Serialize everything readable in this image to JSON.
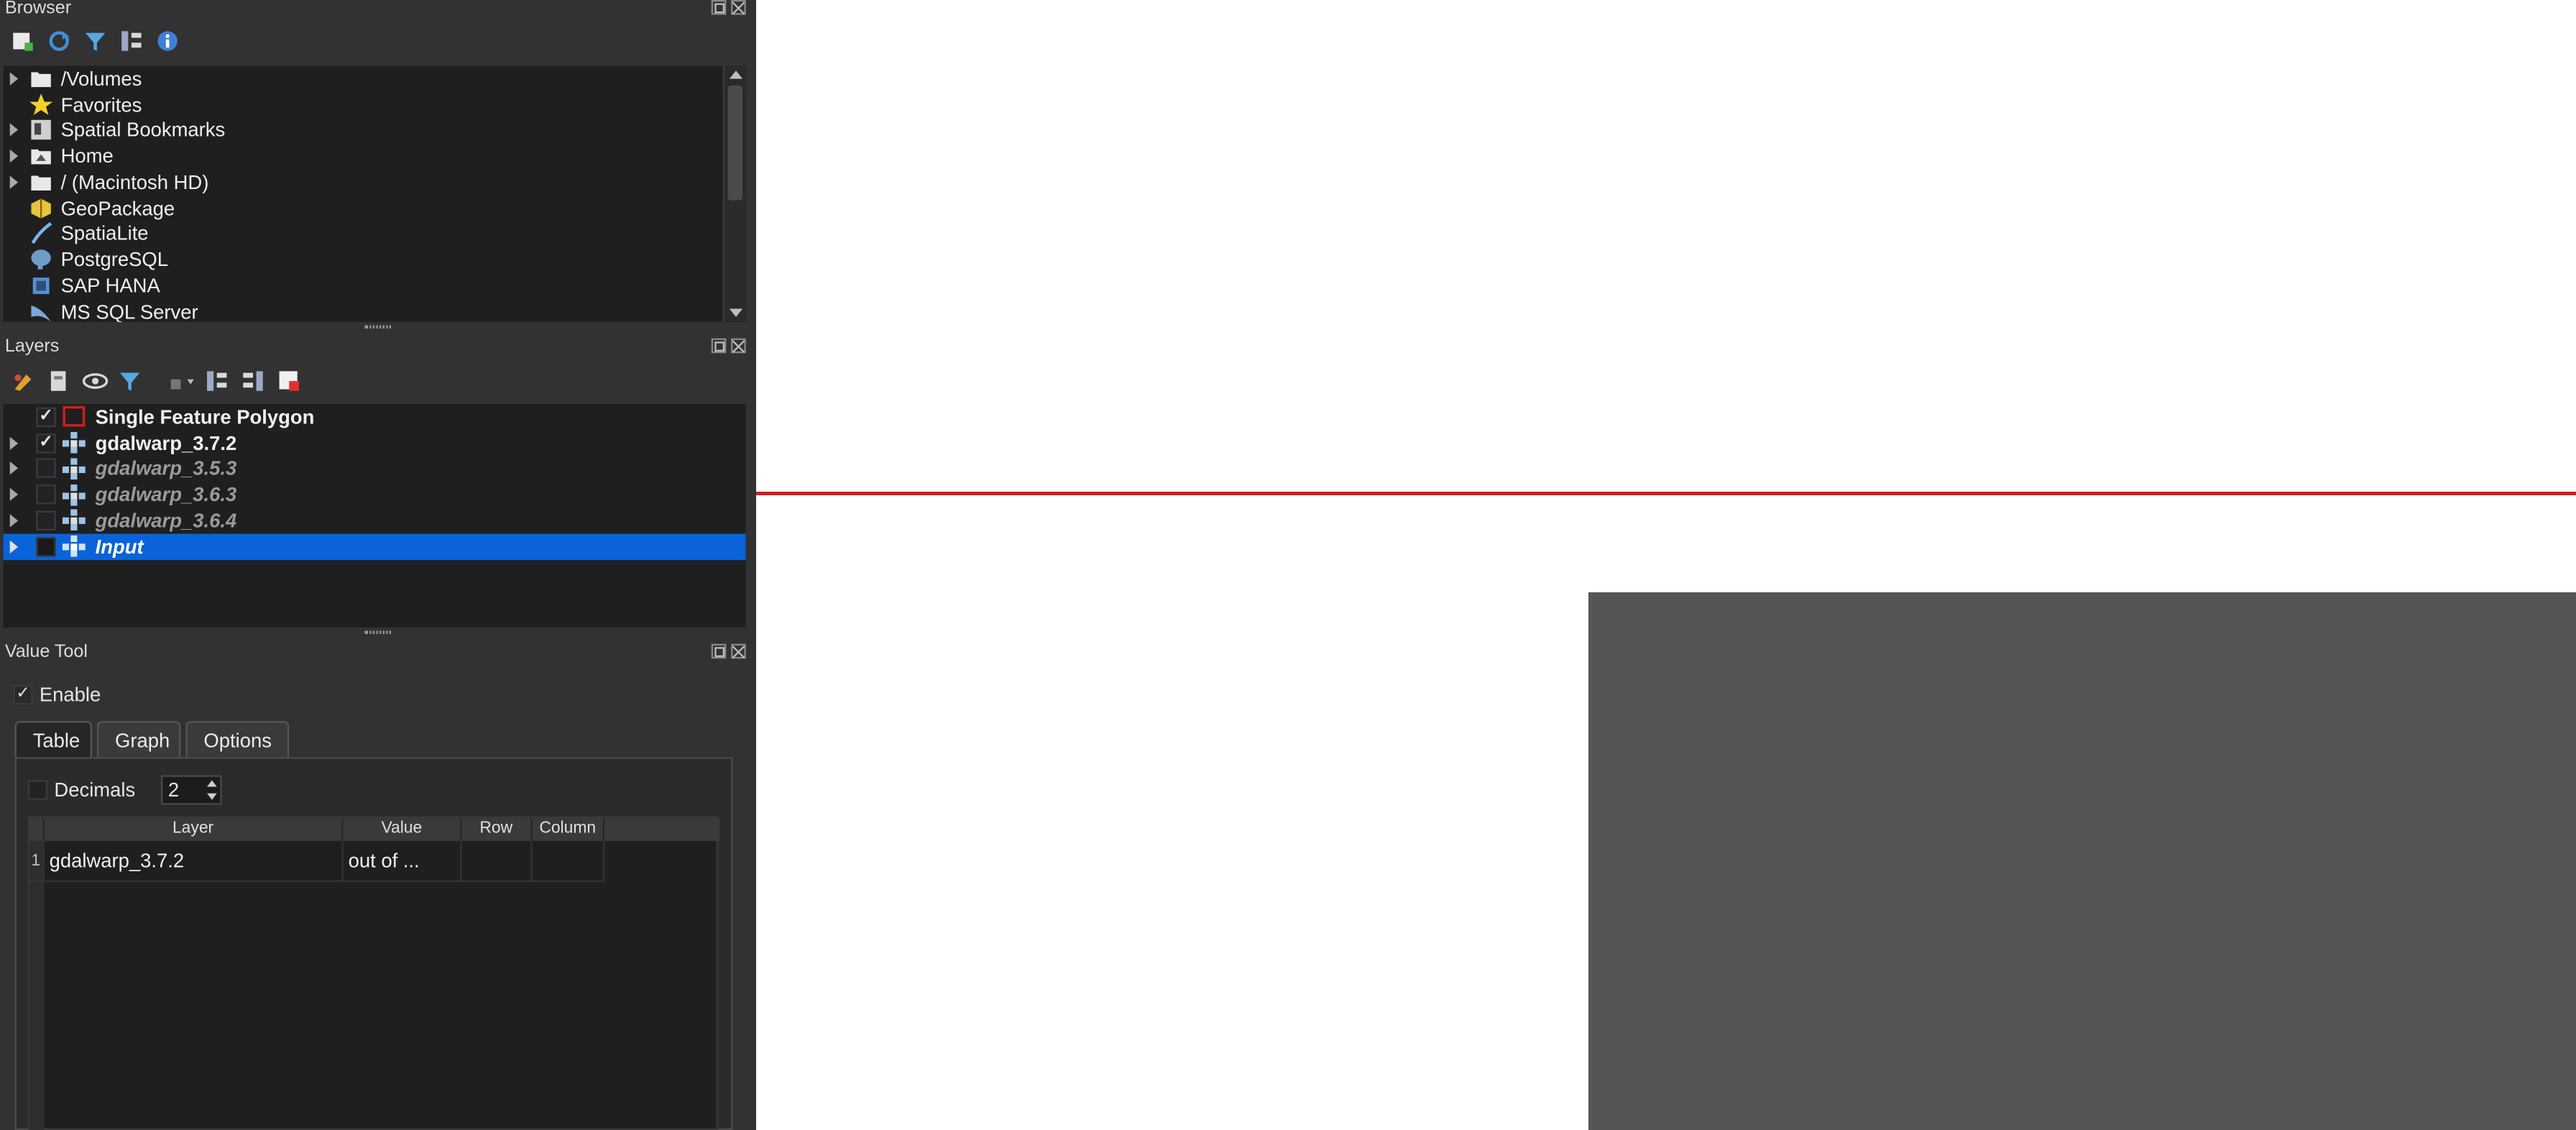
{
  "browser": {
    "title": "Browser",
    "items": [
      {
        "label": "/Volumes",
        "icon": "folder-icon",
        "expandable": true
      },
      {
        "label": "Favorites",
        "icon": "star-icon",
        "expandable": false
      },
      {
        "label": "Spatial Bookmarks",
        "icon": "bookmark-icon",
        "expandable": true
      },
      {
        "label": "Home",
        "icon": "home-folder-icon",
        "expandable": true
      },
      {
        "label": "/ (Macintosh HD)",
        "icon": "folder-icon",
        "expandable": true
      },
      {
        "label": "GeoPackage",
        "icon": "geopackage-icon",
        "expandable": false
      },
      {
        "label": "SpatiaLite",
        "icon": "spatialite-icon",
        "expandable": false
      },
      {
        "label": "PostgreSQL",
        "icon": "postgresql-icon",
        "expandable": false
      },
      {
        "label": "SAP HANA",
        "icon": "sap-hana-icon",
        "expandable": false
      },
      {
        "label": "MS SQL Server",
        "icon": "mssql-icon",
        "expandable": false
      }
    ]
  },
  "layers": {
    "title": "Layers",
    "items": [
      {
        "label": "Single Feature Polygon",
        "checked": true,
        "style": "bold",
        "icon": "polygon-layer-icon",
        "expandable": false
      },
      {
        "label": "gdalwarp_3.7.2",
        "checked": true,
        "style": "bold",
        "icon": "raster-layer-icon",
        "expandable": true
      },
      {
        "label": "gdalwarp_3.5.3",
        "checked": false,
        "style": "bold-italic-dim",
        "icon": "raster-layer-icon",
        "expandable": true
      },
      {
        "label": "gdalwarp_3.6.3",
        "checked": false,
        "style": "bold-italic-dim",
        "icon": "raster-layer-icon",
        "expandable": true
      },
      {
        "label": "gdalwarp_3.6.4",
        "checked": false,
        "style": "bold-italic-dim",
        "icon": "raster-layer-icon",
        "expandable": true
      },
      {
        "label": "Input",
        "checked": false,
        "style": "bold-italic-underline",
        "icon": "raster-layer-icon",
        "expandable": true,
        "selected": true
      }
    ]
  },
  "value_tool": {
    "title": "Value Tool",
    "enable_label": "Enable",
    "enable_checked": true,
    "tabs": [
      "Table",
      "Graph",
      "Options"
    ],
    "active_tab": "Table",
    "decimals_label": "Decimals",
    "decimals_value": "2",
    "columns": [
      "Layer",
      "Value",
      "Row",
      "Column"
    ],
    "rows": [
      {
        "index": "1",
        "layer": "gdalwarp_3.7.2",
        "value": "out of ...",
        "row": "",
        "column": ""
      }
    ]
  },
  "colors": {
    "selection": "#0a63d8",
    "polygon_outline": "#d21e1e",
    "raster_fill": "#555555"
  }
}
